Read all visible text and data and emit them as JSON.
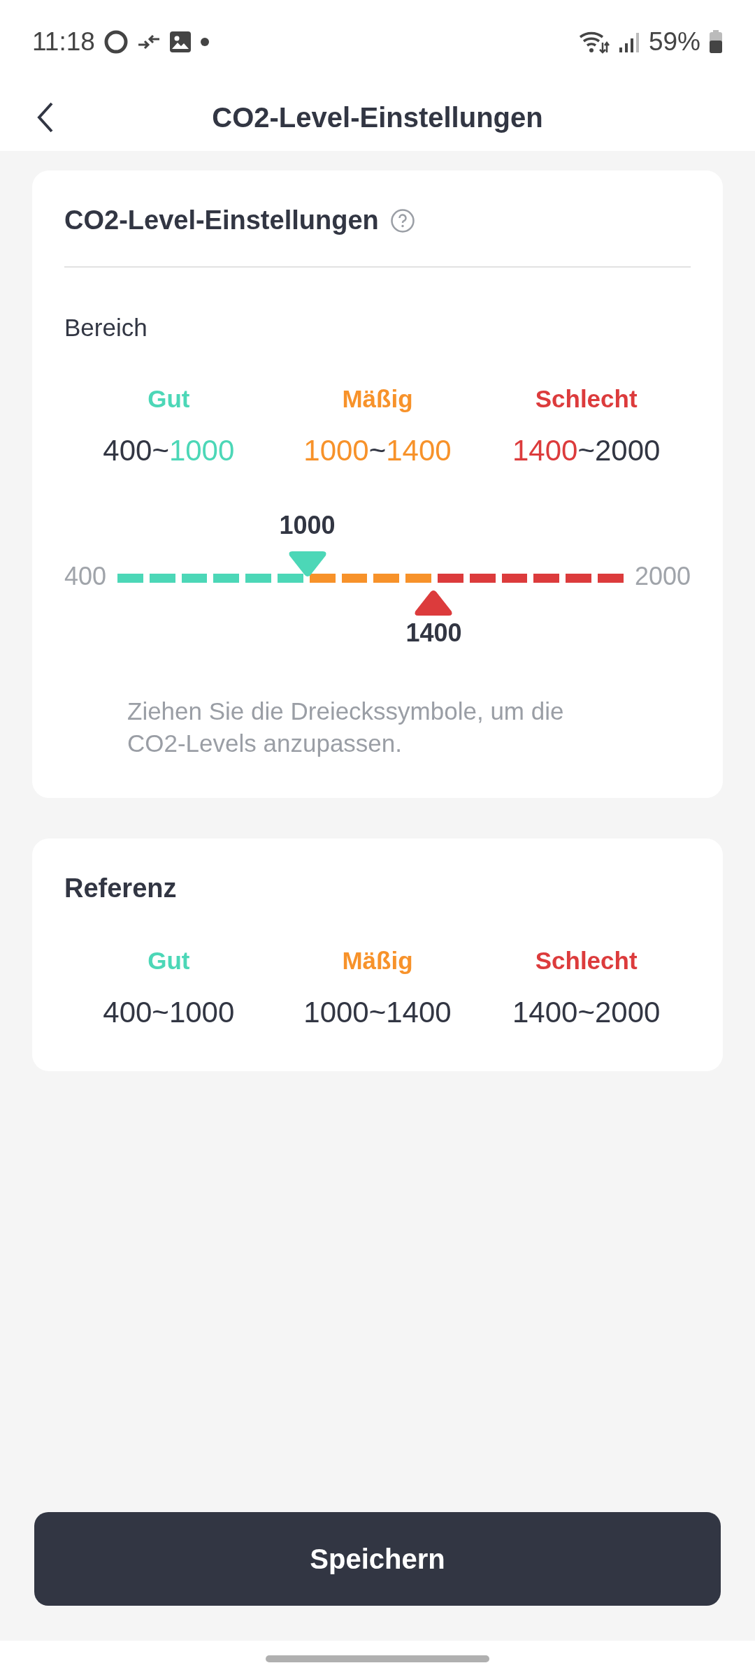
{
  "status_bar": {
    "time": "11:18",
    "battery": "59%"
  },
  "header": {
    "title": "CO2-Level-Einstellungen"
  },
  "settings_card": {
    "title": "CO2-Level-Einstellungen",
    "section_label": "Bereich",
    "ranges": [
      {
        "label": "Gut",
        "color": "#4cd7b7",
        "low": "400",
        "separator": "~",
        "high": "1000",
        "low_colored": false,
        "high_colored": true
      },
      {
        "label": "Mäßig",
        "color": "#f7922a",
        "low": "1000",
        "separator": "~",
        "high": "1400",
        "low_colored": true,
        "high_colored": true
      },
      {
        "label": "Schlecht",
        "color": "#dc3b3c",
        "low": "1400",
        "separator": "~",
        "high": "2000",
        "low_colored": true,
        "high_colored": false
      }
    ],
    "slider": {
      "min_label": "400",
      "max_label": "2000",
      "thumbs": [
        {
          "value": "1000",
          "level": 0.375,
          "color": "#4cd7b7",
          "kind": "down"
        },
        {
          "value": "1400",
          "level": 0.625,
          "color": "#dc3b3c",
          "kind": "up"
        }
      ]
    },
    "hint": "Ziehen Sie die Dreieckssymbole, um die CO2-Levels anzupassen."
  },
  "reference_card": {
    "title": "Referenz",
    "ranges": [
      {
        "label": "Gut",
        "color": "#4cd7b7",
        "text": "400~1000"
      },
      {
        "label": "Mäßig",
        "color": "#f7922a",
        "text": "1000~1400"
      },
      {
        "label": "Schlecht",
        "color": "#dc3b3c",
        "text": "1400~2000"
      }
    ]
  },
  "save_button": {
    "label": "Speichern"
  }
}
